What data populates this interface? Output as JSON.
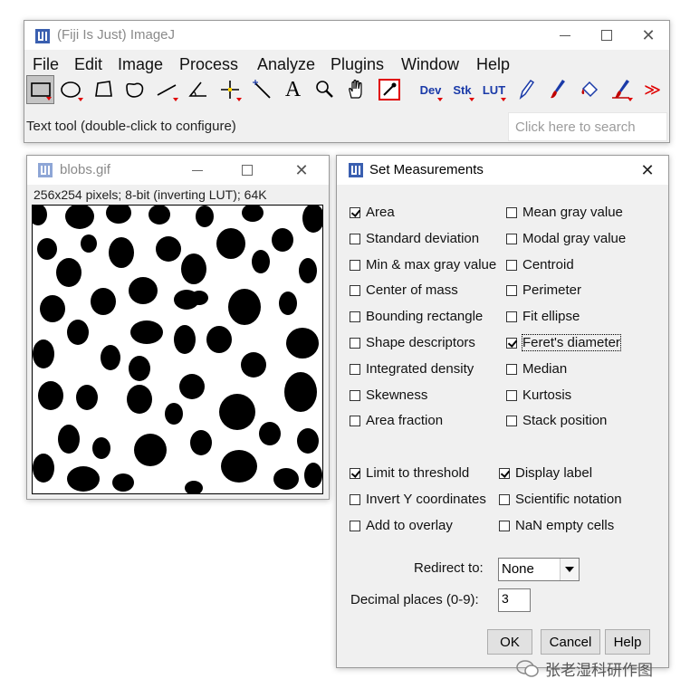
{
  "main_window": {
    "title": "(Fiji Is Just) ImageJ",
    "menus": [
      "File",
      "Edit",
      "Image",
      "Process",
      "Analyze",
      "Plugins",
      "Window",
      "Help"
    ],
    "tools": [
      {
        "name": "rectangle-tool",
        "icon": "rectangle-icon",
        "selected": true
      },
      {
        "name": "oval-tool",
        "icon": "oval-icon"
      },
      {
        "name": "polygon-tool",
        "icon": "polygon-icon"
      },
      {
        "name": "freehand-tool",
        "icon": "freehand-icon"
      },
      {
        "name": "line-tool",
        "icon": "line-icon"
      },
      {
        "name": "angle-tool",
        "icon": "angle-icon"
      },
      {
        "name": "point-tool",
        "icon": "crosshair-icon"
      },
      {
        "name": "wand-tool",
        "icon": "wand-icon"
      },
      {
        "name": "text-tool",
        "icon": "text-icon",
        "label": "A"
      },
      {
        "name": "zoom-tool",
        "icon": "magnifier-icon"
      },
      {
        "name": "scroll-tool",
        "icon": "hand-icon"
      },
      {
        "name": "color-picker-tool",
        "icon": "eyedropper-icon"
      },
      {
        "name": "dev-menu-tool",
        "icon": "dev-icon",
        "label": "Dev"
      },
      {
        "name": "stack-menu-tool",
        "icon": "stack-icon",
        "label": "Stk"
      },
      {
        "name": "lut-menu-tool",
        "icon": "lut-icon",
        "label": "LUT"
      },
      {
        "name": "pencil-tool",
        "icon": "pencil-icon"
      },
      {
        "name": "paintbrush-tool",
        "icon": "paintbrush-icon"
      },
      {
        "name": "flood-fill-tool",
        "icon": "bucket-icon"
      },
      {
        "name": "brush-menu-tool",
        "icon": "brush-icon"
      },
      {
        "name": "more-tools",
        "icon": "double-chevron-right-icon",
        "label": "≫"
      }
    ],
    "status": "Text tool (double-click to configure)",
    "search_placeholder": "Click here to search"
  },
  "image_window": {
    "title": "blobs.gif",
    "info": "256x254 pixels; 8-bit (inverting LUT); 64K"
  },
  "dialog": {
    "title": "Set Measurements",
    "left_options": [
      {
        "label": "Area",
        "checked": true
      },
      {
        "label": "Standard deviation",
        "checked": false
      },
      {
        "label": "Min & max gray value",
        "checked": false
      },
      {
        "label": "Center of mass",
        "checked": false
      },
      {
        "label": "Bounding rectangle",
        "checked": false
      },
      {
        "label": "Shape descriptors",
        "checked": false
      },
      {
        "label": "Integrated density",
        "checked": false
      },
      {
        "label": "Skewness",
        "checked": false
      },
      {
        "label": "Area fraction",
        "checked": false
      }
    ],
    "right_options": [
      {
        "label": "Mean gray value",
        "checked": false
      },
      {
        "label": "Modal gray value",
        "checked": false
      },
      {
        "label": "Centroid",
        "checked": false
      },
      {
        "label": "Perimeter",
        "checked": false
      },
      {
        "label": "Fit ellipse",
        "checked": false
      },
      {
        "label": "Feret's diameter",
        "checked": true
      },
      {
        "label": "Median",
        "checked": false
      },
      {
        "label": "Kurtosis",
        "checked": false
      },
      {
        "label": "Stack position",
        "checked": false
      }
    ],
    "lower_left": [
      {
        "label": "Limit to threshold",
        "checked": true
      },
      {
        "label": "Invert Y coordinates",
        "checked": false
      },
      {
        "label": "Add to overlay",
        "checked": false
      }
    ],
    "lower_right": [
      {
        "label": "Display label",
        "checked": true
      },
      {
        "label": "Scientific notation",
        "checked": false
      },
      {
        "label": "NaN empty cells",
        "checked": false
      }
    ],
    "redirect_label": "Redirect to:",
    "redirect_value": "None",
    "decimal_label": "Decimal places (0-9):",
    "decimal_value": "3",
    "ok": "OK",
    "cancel": "Cancel",
    "help": "Help"
  },
  "watermark": "张老湿科研作图"
}
